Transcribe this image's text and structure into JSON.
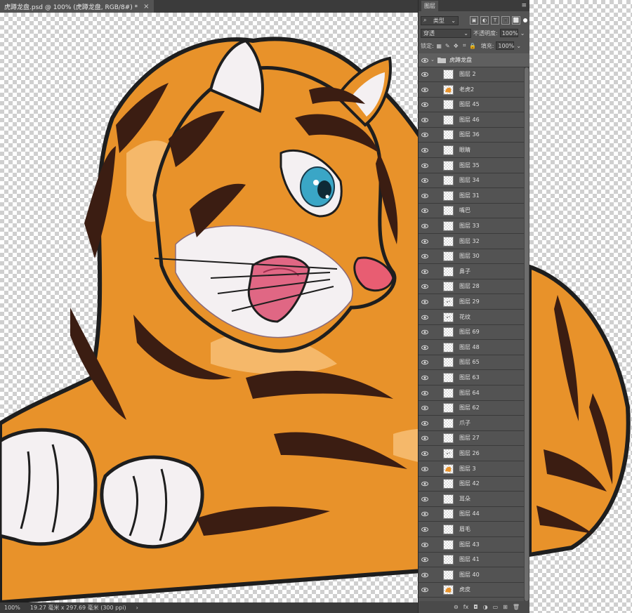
{
  "document": {
    "tab_title": "虎蹲龙盘.psd @ 100% (虎蹲龙盘, RGB/8#) *",
    "close_glyph": "×"
  },
  "status": {
    "zoom": "100%",
    "doc_info": "19.27 毫米 x 297.69 毫米 (300 ppi)",
    "arrow": "›"
  },
  "colors": {
    "fur_orange": "#e8922a",
    "fur_light": "#f7c27a",
    "stripe": "#3b1d12",
    "outline": "#1e1e1e",
    "white_fur": "#f4f0f2",
    "eye": "#3aa6c6",
    "tongue": "#e06784",
    "nose": "#e85d72"
  },
  "panel": {
    "title": "图层",
    "menu_glyph": "≡",
    "filter_label": "类型",
    "filter_icons": [
      "image-filter-icon",
      "adjustment-filter-icon",
      "text-filter-icon",
      "shape-filter-icon",
      "smart-object-filter-icon"
    ],
    "filter_glyphs": [
      "▣",
      "◐",
      "T",
      "⬚",
      "⬜"
    ],
    "blend_mode": "穿透",
    "opacity_label": "不透明度:",
    "opacity_value": "100%",
    "lock_label": "锁定:",
    "fill_label": "填充:",
    "fill_value": "100%",
    "dropdown_glyph": "⌄",
    "group_name": "虎蹲龙盘",
    "layers": [
      {
        "name": "图层 2",
        "thumb": "blank"
      },
      {
        "name": "老虎2",
        "thumb": "tiger"
      },
      {
        "name": "图层 45",
        "thumb": "blank"
      },
      {
        "name": "图层 46",
        "thumb": "blank"
      },
      {
        "name": "图层 36",
        "thumb": "blank"
      },
      {
        "name": "眼睛",
        "thumb": "blank"
      },
      {
        "name": "图层 35",
        "thumb": "blank"
      },
      {
        "name": "图层 34",
        "thumb": "blank"
      },
      {
        "name": "图层 31",
        "thumb": "blank"
      },
      {
        "name": "嘴巴",
        "thumb": "blank"
      },
      {
        "name": "图层 33",
        "thumb": "blank"
      },
      {
        "name": "图层 32",
        "thumb": "blank"
      },
      {
        "name": "图层 30",
        "thumb": "blank"
      },
      {
        "name": "鼻子",
        "thumb": "blank"
      },
      {
        "name": "图层 28",
        "thumb": "blank"
      },
      {
        "name": "图层 29",
        "thumb": "dots"
      },
      {
        "name": "花纹",
        "thumb": "dots"
      },
      {
        "name": "图层 69",
        "thumb": "blank"
      },
      {
        "name": "图层 48",
        "thumb": "blank"
      },
      {
        "name": "图层 65",
        "thumb": "blank"
      },
      {
        "name": "图层 63",
        "thumb": "blank"
      },
      {
        "name": "图层 64",
        "thumb": "blank"
      },
      {
        "name": "图层 62",
        "thumb": "blank"
      },
      {
        "name": "爪子",
        "thumb": "blank"
      },
      {
        "name": "图层 27",
        "thumb": "blank"
      },
      {
        "name": "图层 26",
        "thumb": "dots"
      },
      {
        "name": "图层 3",
        "thumb": "tiger"
      },
      {
        "name": "图层 42",
        "thumb": "blank"
      },
      {
        "name": "耳朵",
        "thumb": "blank"
      },
      {
        "name": "图层 44",
        "thumb": "blank"
      },
      {
        "name": "眉毛",
        "thumb": "blank"
      },
      {
        "name": "图层 43",
        "thumb": "blank"
      },
      {
        "name": "图层 41",
        "thumb": "blank"
      },
      {
        "name": "图层 40",
        "thumb": "blank"
      },
      {
        "name": "虎皮",
        "thumb": "tiger"
      }
    ],
    "footer_buttons": [
      "link-icon",
      "fx-icon",
      "mask-icon",
      "adjustment-icon",
      "folder-icon",
      "new-layer-icon",
      "trash-icon"
    ],
    "footer_glyphs": [
      "⊖",
      "fx",
      "◘",
      "◑",
      "▭",
      "⊞",
      "🗑"
    ]
  }
}
